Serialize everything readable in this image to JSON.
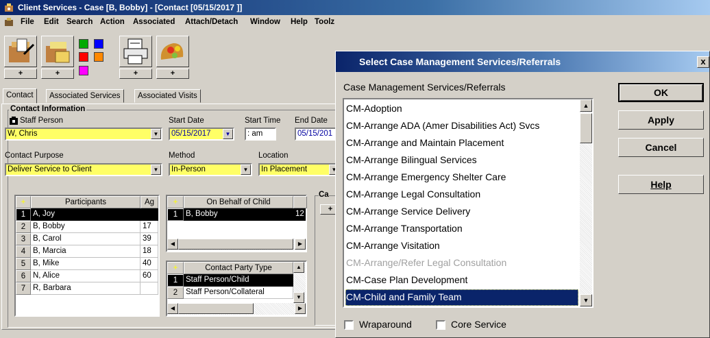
{
  "window": {
    "title": "Client Services - Case [B, Bobby] - [Contact [05/15/2017 ]]"
  },
  "menu": [
    "File",
    "Edit",
    "Search",
    "Action",
    "Associated",
    "Attach/Detach",
    "Window",
    "Help",
    "Toolz"
  ],
  "toolbar": {
    "plus": "+",
    "colors": [
      "#00aa00",
      "#0000ff",
      "#ff0000",
      "#ff8800",
      "#ff00ff"
    ]
  },
  "tabs": [
    "Contact",
    "Associated Services",
    "Associated Visits"
  ],
  "contact": {
    "section_title": "Contact Information",
    "staff_person_label": "Staff Person",
    "staff_person_value": "W, Chris",
    "start_date_label": "Start Date",
    "start_date_value": "05/15/2017",
    "start_time_label": "Start Time",
    "start_time_value": ": am",
    "end_date_label": "End Date",
    "end_date_value": "05/15/201",
    "purpose_label": "Contact Purpose",
    "purpose_value": "Deliver Service to Client",
    "method_label": "Method",
    "method_value": "In-Person",
    "location_label": "Location",
    "location_value": "In Placement",
    "partial_label": "Ca"
  },
  "participants": {
    "header_participants": "Participants",
    "header_age": "Ag",
    "rows": [
      {
        "num": "1",
        "name": "A, Joy",
        "age": ""
      },
      {
        "num": "2",
        "name": "B, Bobby",
        "age": "17"
      },
      {
        "num": "3",
        "name": "B, Carol",
        "age": "39"
      },
      {
        "num": "4",
        "name": "B, Marcia",
        "age": "18"
      },
      {
        "num": "5",
        "name": "B, Mike",
        "age": "40"
      },
      {
        "num": "6",
        "name": "N, Alice",
        "age": "60"
      },
      {
        "num": "7",
        "name": "R, Barbara",
        "age": ""
      }
    ]
  },
  "on_behalf": {
    "header": "On Behalf of Child",
    "rows": [
      {
        "num": "1",
        "name": "B, Bobby",
        "extra": "12"
      }
    ]
  },
  "contact_party": {
    "header": "Contact Party Type",
    "rows": [
      {
        "num": "1",
        "name": "Staff Person/Child"
      },
      {
        "num": "2",
        "name": "Staff Person/Collateral"
      }
    ]
  },
  "dialog": {
    "title": "Select Case Management Services/Referrals",
    "close": "x",
    "list_label": "Case Management Services/Referrals",
    "items": [
      {
        "label": "CM-Adoption",
        "state": "normal"
      },
      {
        "label": "CM-Arrange ADA (Amer Disabilities Act) Svcs",
        "state": "normal"
      },
      {
        "label": "CM-Arrange and Maintain Placement",
        "state": "normal"
      },
      {
        "label": "CM-Arrange Bilingual Services",
        "state": "normal"
      },
      {
        "label": "CM-Arrange Emergency Shelter Care",
        "state": "normal"
      },
      {
        "label": "CM-Arrange Legal Consultation",
        "state": "normal"
      },
      {
        "label": "CM-Arrange Service Delivery",
        "state": "normal"
      },
      {
        "label": "CM-Arrange Transportation",
        "state": "normal"
      },
      {
        "label": "CM-Arrange Visitation",
        "state": "normal"
      },
      {
        "label": "CM-Arrange/Refer Legal Consultation",
        "state": "disabled"
      },
      {
        "label": "CM-Case Plan Development",
        "state": "normal"
      },
      {
        "label": "CM-Child and Family Team",
        "state": "selected"
      }
    ],
    "buttons": {
      "ok": "OK",
      "apply": "Apply",
      "cancel": "Cancel",
      "help": "Help"
    },
    "wraparound_label": "Wraparound",
    "core_service_label": "Core Service"
  }
}
